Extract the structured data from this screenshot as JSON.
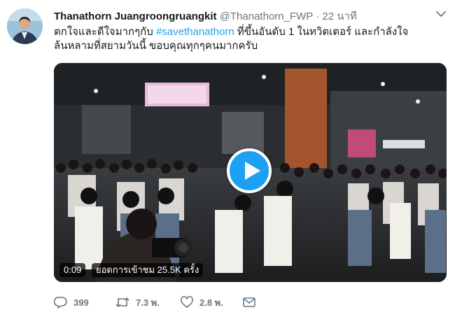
{
  "author": {
    "name": "Thanathorn Juangroongruangkit",
    "handle": "@Thanathorn_FWP",
    "separator": "·",
    "time": "22 นาที"
  },
  "tweet": {
    "text_before": "ตกใจและดีใจมากๆกับ ",
    "hashtag": "#savethanathorn",
    "text_after": " ที่ขึ้นอันดับ 1 ในทวิตเตอร์ และกำลังใจล้นหลามที่สยามวันนี้ ขอบคุณทุกๆคนมากครับ"
  },
  "video": {
    "duration": "0:09",
    "views": "ยอดการเข้าชม 25.5K ครั้ง"
  },
  "actions": {
    "reply_count": "399",
    "retweet_count": "7.3 พ.",
    "like_count": "2.8 พ."
  },
  "colors": {
    "accent": "#1da1f2",
    "muted": "#657786"
  }
}
